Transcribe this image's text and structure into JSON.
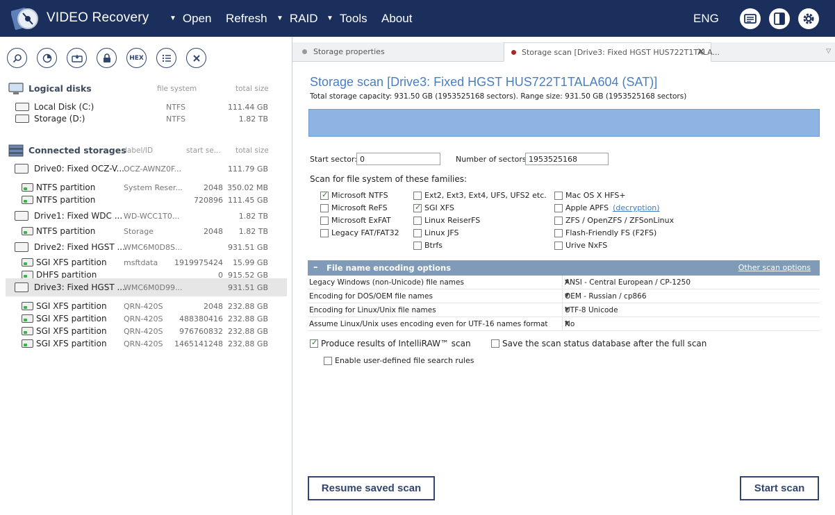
{
  "app": {
    "title": "VIDEO Recovery",
    "menu": [
      {
        "label": "Open",
        "has_caret": true
      },
      {
        "label": "Refresh",
        "has_caret": false
      },
      {
        "label": "RAID",
        "has_caret": true
      },
      {
        "label": "Tools",
        "has_caret": true
      },
      {
        "label": "About",
        "has_caret": false
      }
    ],
    "language": "ENG",
    "toolbar_icons": [
      "log-icon",
      "panel-icon",
      "settings-icon"
    ],
    "colors": {
      "topbar": "#1b2f5c",
      "accent": "#4a7fbf",
      "range_bar": "#8db4e2"
    }
  },
  "left_panel": {
    "tools": [
      {
        "icon": "search-icon"
      },
      {
        "icon": "scan-icon"
      },
      {
        "icon": "image-icon"
      },
      {
        "icon": "lock-icon"
      },
      {
        "icon": "hex-icon",
        "label": "HEX"
      },
      {
        "icon": "list-icon"
      },
      {
        "icon": "close-icon"
      }
    ],
    "logical_disks": {
      "title": "Logical disks",
      "col_fs": "file system",
      "col_size": "total size",
      "items": [
        {
          "name": "Local Disk (C:)",
          "fs": "NTFS",
          "size": "111.44 GB"
        },
        {
          "name": "Storage (D:)",
          "fs": "NTFS",
          "size": "1.82 TB"
        }
      ]
    },
    "connected_storages": {
      "title": "Connected storages",
      "col_label": "label/ID",
      "col_start": "start se...",
      "col_size": "total size",
      "items": [
        {
          "kind": "drive",
          "name": "Drive0: Fixed OCZ-V...",
          "label": "OCZ-AWNZ0F...",
          "start": "",
          "size": "111.79 GB"
        },
        {
          "kind": "part",
          "name": "NTFS partition",
          "label": "System Reser...",
          "start": "2048",
          "size": "350.02 MB"
        },
        {
          "kind": "part",
          "name": "NTFS partition",
          "label": "",
          "start": "720896",
          "size": "111.45 GB"
        },
        {
          "kind": "drive",
          "name": "Drive1: Fixed WDC ...",
          "label": "WD-WCC1T0...",
          "start": "",
          "size": "1.82 TB"
        },
        {
          "kind": "part",
          "name": "NTFS partition",
          "label": "Storage",
          "start": "2048",
          "size": "1.82 TB"
        },
        {
          "kind": "drive",
          "name": "Drive2: Fixed HGST ...",
          "label": "WMC6M0D8S...",
          "start": "",
          "size": "931.51 GB"
        },
        {
          "kind": "part",
          "name": "SGI XFS partition",
          "label": "msftdata",
          "start": "1919975424",
          "size": "15.99 GB"
        },
        {
          "kind": "part",
          "name": "DHFS partition",
          "label": "",
          "start": "0",
          "size": "915.52 GB"
        },
        {
          "kind": "drive",
          "name": "Drive3: Fixed HGST ...",
          "label": "WMC6M0D99...",
          "start": "",
          "size": "931.51 GB",
          "selected": true
        },
        {
          "kind": "part",
          "name": "SGI XFS partition",
          "label": "QRN-420S",
          "start": "2048",
          "size": "232.88 GB"
        },
        {
          "kind": "part",
          "name": "SGI XFS partition",
          "label": "QRN-420S",
          "start": "488380416",
          "size": "232.88 GB"
        },
        {
          "kind": "part",
          "name": "SGI XFS partition",
          "label": "QRN-420S",
          "start": "976760832",
          "size": "232.88 GB"
        },
        {
          "kind": "part",
          "name": "SGI XFS partition",
          "label": "QRN-420S",
          "start": "1465141248",
          "size": "232.88 GB"
        }
      ]
    }
  },
  "tabs": [
    {
      "label": "Storage properties",
      "active": false,
      "dot_color": "#9a9a9a"
    },
    {
      "label": "Storage scan [Drive3: Fixed HGST HUS722T1TALA...",
      "active": true,
      "dot_color": "#a52a2a"
    }
  ],
  "scan": {
    "title": "Storage scan [Drive3: Fixed HGST HUS722T1TALA604 (SAT)]",
    "subtitle": "Total storage capacity: 931.50 GB (1953525168 sectors). Range size: 931.50 GB (1953525168 sectors)",
    "start_sector_label": "Start sector:",
    "start_sector_value": "0",
    "num_sectors_label": "Number of sectors:",
    "num_sectors_value": "1953525168",
    "families_label": "Scan for file system of these families:",
    "families": [
      [
        {
          "label": "Microsoft NTFS",
          "checked": true
        },
        {
          "label": "Microsoft ReFS",
          "checked": false
        },
        {
          "label": "Microsoft ExFAT",
          "checked": false
        },
        {
          "label": "Legacy FAT/FAT32",
          "checked": false
        }
      ],
      [
        {
          "label": "Ext2, Ext3, Ext4, UFS, UFS2 etc.",
          "checked": false
        },
        {
          "label": "SGI XFS",
          "checked": true
        },
        {
          "label": "Linux ReiserFS",
          "checked": false
        },
        {
          "label": "Linux JFS",
          "checked": false
        },
        {
          "label": "Btrfs",
          "checked": false
        }
      ],
      [
        {
          "label": "Mac OS X HFS+",
          "checked": false
        },
        {
          "label": "Apple APFS",
          "checked": false,
          "link": "(decryption)"
        },
        {
          "label": "ZFS / OpenZFS / ZFSonLinux",
          "checked": false
        },
        {
          "label": "Flash-Friendly FS (F2FS)",
          "checked": false
        },
        {
          "label": "Urive NxFS",
          "checked": false
        }
      ]
    ],
    "encoding": {
      "title": "File name encoding options",
      "other_link": "Other scan options",
      "rows": [
        {
          "key": "Legacy Windows (non-Unicode) file names",
          "value": "ANSI - Central European / CP-1250"
        },
        {
          "key": "Encoding for DOS/OEM file names",
          "value": "OEM - Russian / cp866"
        },
        {
          "key": "Encoding for Linux/Unix file names",
          "value": "UTF-8 Unicode"
        },
        {
          "key": "Assume Linux/Unix uses encoding even for UTF-16 names format",
          "value": "No"
        }
      ]
    },
    "intelliraw_label": "Produce results of IntelliRAW™ scan",
    "intelliraw_checked": true,
    "save_db_label": "Save the scan status database after the full scan",
    "save_db_checked": false,
    "user_rules_label": "Enable user-defined file search rules",
    "user_rules_checked": false,
    "resume_button": "Resume saved scan",
    "start_button": "Start scan"
  }
}
